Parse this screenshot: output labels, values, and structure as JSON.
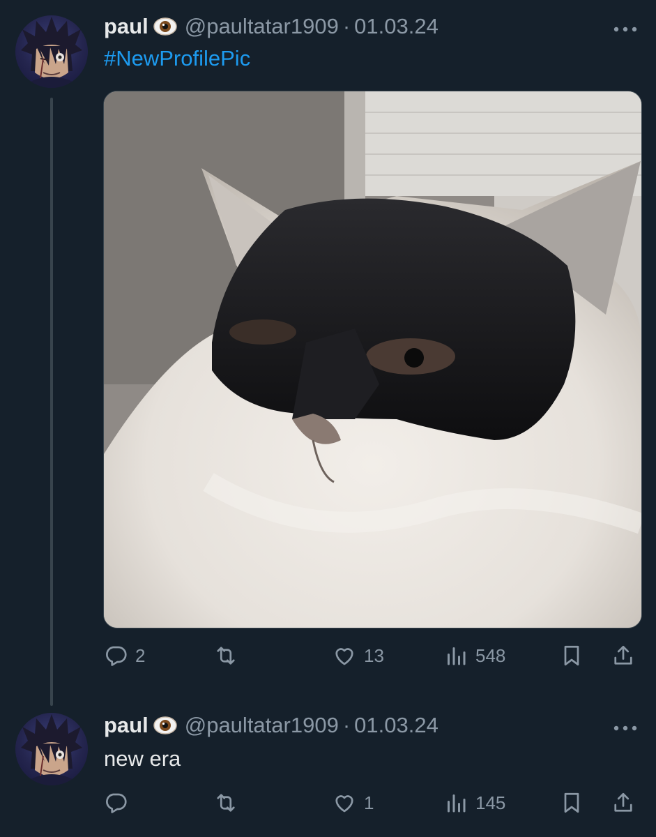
{
  "tweets": [
    {
      "author": {
        "name": "paul",
        "handle": "@paultatar1909",
        "date": "01.03.24"
      },
      "separator": "·",
      "text": "#NewProfilePic",
      "has_media": true,
      "stats": {
        "replies": "2",
        "retweets": "",
        "likes": "13",
        "views": "548"
      }
    },
    {
      "author": {
        "name": "paul",
        "handle": "@paultatar1909",
        "date": "01.03.24"
      },
      "separator": "·",
      "text": "new era",
      "has_media": false,
      "stats": {
        "replies": "",
        "retweets": "",
        "likes": "1",
        "views": "145"
      }
    }
  ],
  "colors": {
    "background": "#15202b",
    "text": "#e7e9ea",
    "muted": "#8b98a5",
    "accent": "#1d9bf0",
    "line": "#38444d"
  },
  "icons": [
    "eye-emoji-icon",
    "more-icon",
    "reply-icon",
    "retweet-icon",
    "like-icon",
    "views-icon",
    "bookmark-icon",
    "share-icon"
  ]
}
